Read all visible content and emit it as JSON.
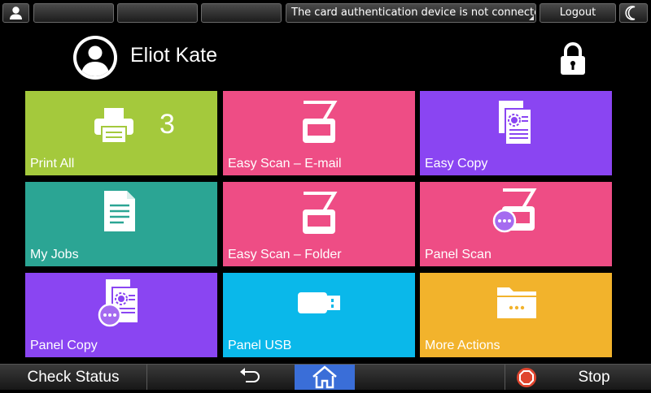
{
  "status_bar": {
    "message": "The card authentication device is not connected.",
    "logout_label": "Logout",
    "icons": [
      "user-icon",
      "moon-icon"
    ]
  },
  "header": {
    "user_name": "Eliot Kate",
    "icons": [
      "avatar-icon",
      "lock-icon"
    ]
  },
  "tiles": [
    {
      "label": "Print All",
      "color": "#a4c93c",
      "icon": "printer-icon",
      "badge": "3"
    },
    {
      "label": "Easy Scan – E-mail",
      "color": "#ee4d85",
      "icon": "scanner-icon"
    },
    {
      "label": "Easy Copy",
      "color": "#8a45f2",
      "icon": "copy-document-icon"
    },
    {
      "label": "My Jobs",
      "color": "#2ba594",
      "icon": "document-icon"
    },
    {
      "label": "Easy Scan – Folder",
      "color": "#ee4d85",
      "icon": "scanner-icon"
    },
    {
      "label": "Panel Scan",
      "color": "#ee4d85",
      "icon": "panel-scanner-icon"
    },
    {
      "label": "Panel Copy",
      "color": "#8a45f2",
      "icon": "panel-copy-icon"
    },
    {
      "label": "Panel USB",
      "color": "#0ab8ea",
      "icon": "usb-icon"
    },
    {
      "label": "More Actions",
      "color": "#f2b32c",
      "icon": "folder-more-icon"
    }
  ],
  "bottom_bar": {
    "check_status_label": "Check Status",
    "stop_label": "Stop",
    "home_color": "#3a6ed8",
    "stop_color": "#e0452e",
    "icons": [
      "back-icon",
      "home-icon",
      "stop-icon"
    ]
  }
}
